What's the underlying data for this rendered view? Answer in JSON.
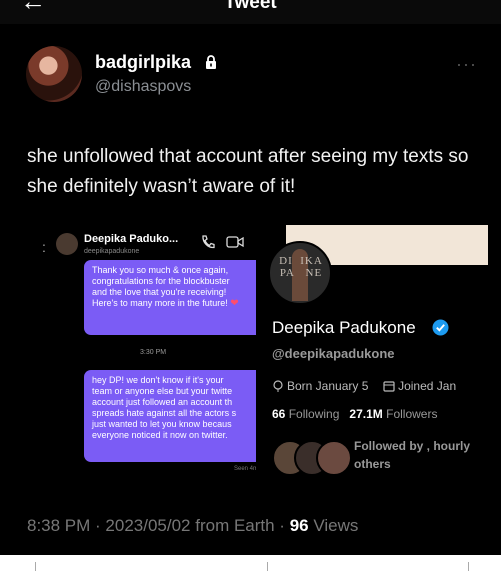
{
  "header": {
    "title": "Tweet",
    "back_icon": "arrow-left-icon"
  },
  "author": {
    "name": "badgirlpika",
    "handle": "@dishaspovs"
  },
  "tweet": {
    "text": "she unfollowed that account after seeing my texts so she definitely wasn’t aware of it!"
  },
  "dm": {
    "contact_name": "Deepika Paduko...",
    "contact_handle": "deepikapadukone",
    "message_1": "Thank you so much & once again,\ncongratulations for the blockbuster\nand the love that you're receiving!\nHere's to many more in the future! ",
    "message_1_emoji": "❤",
    "timestamp": "3:30 PM",
    "message_2": "hey DP! we don't know if it's your\nteam or anyone else but your twitte\naccount just followed an account th\nspreads hate against all the actors s\njust wanted to let you know becaus\neveryone noticed it now on twitter.",
    "seen": "Seen 4m"
  },
  "profile": {
    "avatar_text": "DI  IKA\nPA   NE",
    "name": "Deepika Padukone",
    "handle": "@deepikapadukone",
    "born": "Born January 5",
    "joined": "Joined Jan",
    "following_count": "66",
    "following_label": "Following",
    "followers_count": "27.1M",
    "followers_label": "Followers",
    "followed_by": "Followed by , hourly others"
  },
  "footer": {
    "meta": "8:38 PM · 2023/05/02 from Earth · ",
    "views_count": "96",
    "views_label": " Views"
  },
  "colors": {
    "background": "#000000",
    "dm_bubble": "#7b5cf5",
    "verified": "#1d9bf0"
  }
}
